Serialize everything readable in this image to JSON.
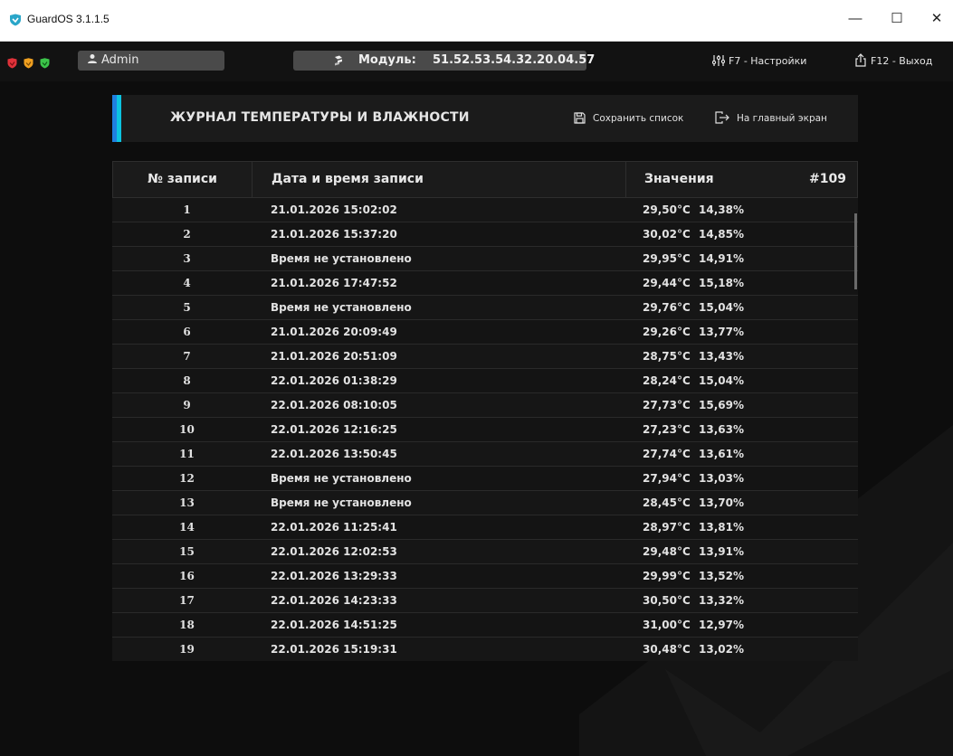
{
  "window": {
    "title": "GuardOS 3.1.1.5",
    "controls": {
      "minimize": "—",
      "maximize": "☐",
      "close": "✕"
    }
  },
  "topbar": {
    "status_colors": [
      "#e0323a",
      "#f0a020",
      "#3cc44a"
    ],
    "user": "Admin",
    "module_label": "Модуль:",
    "module_value": "51.52.53.54.32.20.04.57",
    "settings": "F7 - Настройки",
    "exit": "F12 - Выход"
  },
  "panel": {
    "title": "ЖУРНАЛ ТЕМПЕРАТУРЫ И ВЛАЖНОСТИ",
    "save_label": "Сохранить список",
    "home_label": "На главный экран",
    "accent_colors": [
      "#1f7fe0",
      "#0cc4e0"
    ]
  },
  "table": {
    "headers": {
      "num": "№ записи",
      "date": "Дата и время записи",
      "values": "Значения",
      "count": "#109"
    },
    "rows": [
      {
        "n": "1",
        "date": "21.01.2026 15:02:02",
        "temp": "29,50°C",
        "hum": "14,38%"
      },
      {
        "n": "2",
        "date": "21.01.2026 15:37:20",
        "temp": "30,02°C",
        "hum": "14,85%"
      },
      {
        "n": "3",
        "date": "Время не установлено",
        "temp": "29,95°C",
        "hum": "14,91%"
      },
      {
        "n": "4",
        "date": "21.01.2026 17:47:52",
        "temp": "29,44°C",
        "hum": "15,18%"
      },
      {
        "n": "5",
        "date": "Время не установлено",
        "temp": "29,76°C",
        "hum": "15,04%"
      },
      {
        "n": "6",
        "date": "21.01.2026 20:09:49",
        "temp": "29,26°C",
        "hum": "13,77%"
      },
      {
        "n": "7",
        "date": "21.01.2026 20:51:09",
        "temp": "28,75°C",
        "hum": "13,43%"
      },
      {
        "n": "8",
        "date": "22.01.2026 01:38:29",
        "temp": "28,24°C",
        "hum": "15,04%"
      },
      {
        "n": "9",
        "date": "22.01.2026 08:10:05",
        "temp": "27,73°C",
        "hum": "15,69%"
      },
      {
        "n": "10",
        "date": "22.01.2026 12:16:25",
        "temp": "27,23°C",
        "hum": "13,63%"
      },
      {
        "n": "11",
        "date": "22.01.2026 13:50:45",
        "temp": "27,74°C",
        "hum": "13,61%"
      },
      {
        "n": "12",
        "date": "Время не установлено",
        "temp": "27,94°C",
        "hum": "13,03%"
      },
      {
        "n": "13",
        "date": "Время не установлено",
        "temp": "28,45°C",
        "hum": "13,70%"
      },
      {
        "n": "14",
        "date": "22.01.2026 11:25:41",
        "temp": "28,97°C",
        "hum": "13,81%"
      },
      {
        "n": "15",
        "date": "22.01.2026 12:02:53",
        "temp": "29,48°C",
        "hum": "13,91%"
      },
      {
        "n": "16",
        "date": "22.01.2026 13:29:33",
        "temp": "29,99°C",
        "hum": "13,52%"
      },
      {
        "n": "17",
        "date": "22.01.2026 14:23:33",
        "temp": "30,50°C",
        "hum": "13,32%"
      },
      {
        "n": "18",
        "date": "22.01.2026 14:51:25",
        "temp": "31,00°C",
        "hum": "12,97%"
      },
      {
        "n": "19",
        "date": "22.01.2026 15:19:31",
        "temp": "30,48°C",
        "hum": "13,02%"
      }
    ]
  }
}
